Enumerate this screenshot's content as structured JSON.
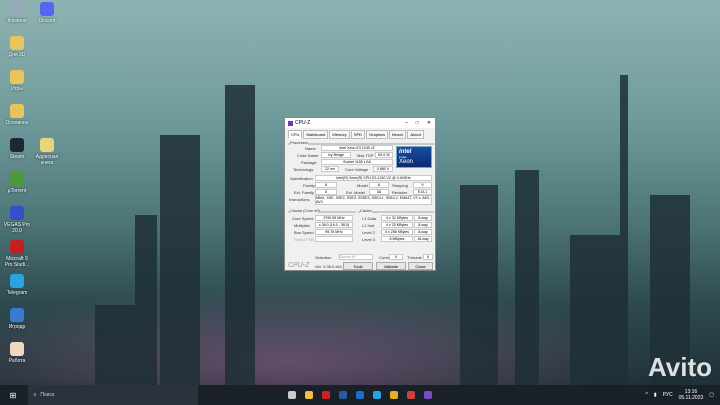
{
  "desktop": {
    "icons": [
      {
        "label": "Корзина",
        "color": "#9ab"
      },
      {
        "label": "Discord",
        "color": "#5865f2"
      },
      {
        "label": "Для 3D",
        "color": "#e8c45a"
      },
      {
        "label": "Игры",
        "color": "#e8c45a"
      },
      {
        "label": "Основное",
        "color": "#e8c45a"
      },
      {
        "label": "Steam",
        "color": "#1b2838"
      },
      {
        "label": "Адресная книга",
        "color": "#e8d47a"
      },
      {
        "label": "µTorrent",
        "color": "#4a9a3a"
      },
      {
        "label": "VEGAS Pro 20.0",
        "color": "#3450c8"
      },
      {
        "label": "Mixcraft 9 Pro Studi...",
        "color": "#c02020"
      },
      {
        "label": "Telegram",
        "color": "#2aa3e0"
      },
      {
        "label": "Игродр",
        "color": "#3a7ad0"
      },
      {
        "label": "Работа",
        "color": "#f0d8c0"
      }
    ]
  },
  "cpuz": {
    "title": "CPU-Z",
    "tabs": [
      "CPU",
      "Mainboard",
      "Memory",
      "SPD",
      "Graphics",
      "Bench",
      "About"
    ],
    "processor": {
      "section": "Processor",
      "name_label": "Name",
      "name": "Intel Xeon E3 1240 v2",
      "codename_label": "Code Name",
      "codename": "Ivy Bridge",
      "maxtdp_label": "Max TDP",
      "maxtdp": "69.0 W",
      "package_label": "Package",
      "package": "Socket 1155 LGA",
      "tech_label": "Technology",
      "tech": "22 nm",
      "voltage_label": "Core Voltage",
      "voltage": "0.880 V",
      "spec_label": "Specification",
      "spec": "Intel(R) Xeon(R) CPU E3-1240 V2 @ 3.40GHz",
      "family_label": "Family",
      "family": "6",
      "model_label": "Model",
      "model": "A",
      "stepping_label": "Stepping",
      "stepping": "9",
      "extfamily_label": "Ext. Family",
      "extfamily": "6",
      "extmodel_label": "Ext. Model",
      "extmodel": "3A",
      "revision_label": "Revision",
      "revision": "E1/L1",
      "instr_label": "Instructions",
      "instr": "MMX, SSE, SSE2, SSE3, SSSE3, SSE4.1, SSE4.2, EM64T, VT-x, AES, AVX",
      "logo_top": "intel",
      "logo_inside": "inside",
      "logo_brand": "Xeon"
    },
    "clocks": {
      "section": "Clocks (Core #0)",
      "speed_label": "Core Speed",
      "speed": "3790.55 MHz",
      "mult_label": "Multiplier",
      "mult": "x 38.0 (16.0 - 38.0)",
      "bus_label": "Bus Speed",
      "bus": "99.76 MHz",
      "fsb_label": "Rated FSB",
      "fsb": ""
    },
    "cache": {
      "section": "Cache",
      "rows": [
        {
          "label": "L1 Data",
          "size": "4 x 32 KBytes",
          "way": "8-way"
        },
        {
          "label": "L1 Inst.",
          "size": "4 x 32 KBytes",
          "way": "8-way"
        },
        {
          "label": "Level 2",
          "size": "4 x 256 KBytes",
          "way": "8-way"
        },
        {
          "label": "Level 3",
          "size": "8 MBytes",
          "way": "16-way"
        }
      ]
    },
    "selection_label": "Selection",
    "selection": "Socket #1",
    "cores_label": "Cores",
    "cores": "4",
    "threads_label": "Threads",
    "threads": "8",
    "brand": "CPU-Z",
    "version": "Ver. 2.08.0.x64",
    "tools": "Tools",
    "validate": "Validate",
    "close": "Close"
  },
  "taskbar": {
    "search_placeholder": "Поиск",
    "lang": "РУС",
    "time": "13:16",
    "date": "05.11.2023",
    "apps": [
      {
        "name": "task-view",
        "color": "#ccc"
      },
      {
        "name": "file-explorer",
        "color": "#f0c040"
      },
      {
        "name": "acrobat",
        "color": "#d02020"
      },
      {
        "name": "photoshop",
        "color": "#2a5aa0"
      },
      {
        "name": "outlook",
        "color": "#1a70c8"
      },
      {
        "name": "telegram",
        "color": "#2aa3e0"
      },
      {
        "name": "chrome",
        "color": "#e8b020"
      },
      {
        "name": "chrome-alt",
        "color": "#d04030"
      },
      {
        "name": "cpuz",
        "color": "#7a4ac0"
      }
    ]
  },
  "watermark": "Avito"
}
